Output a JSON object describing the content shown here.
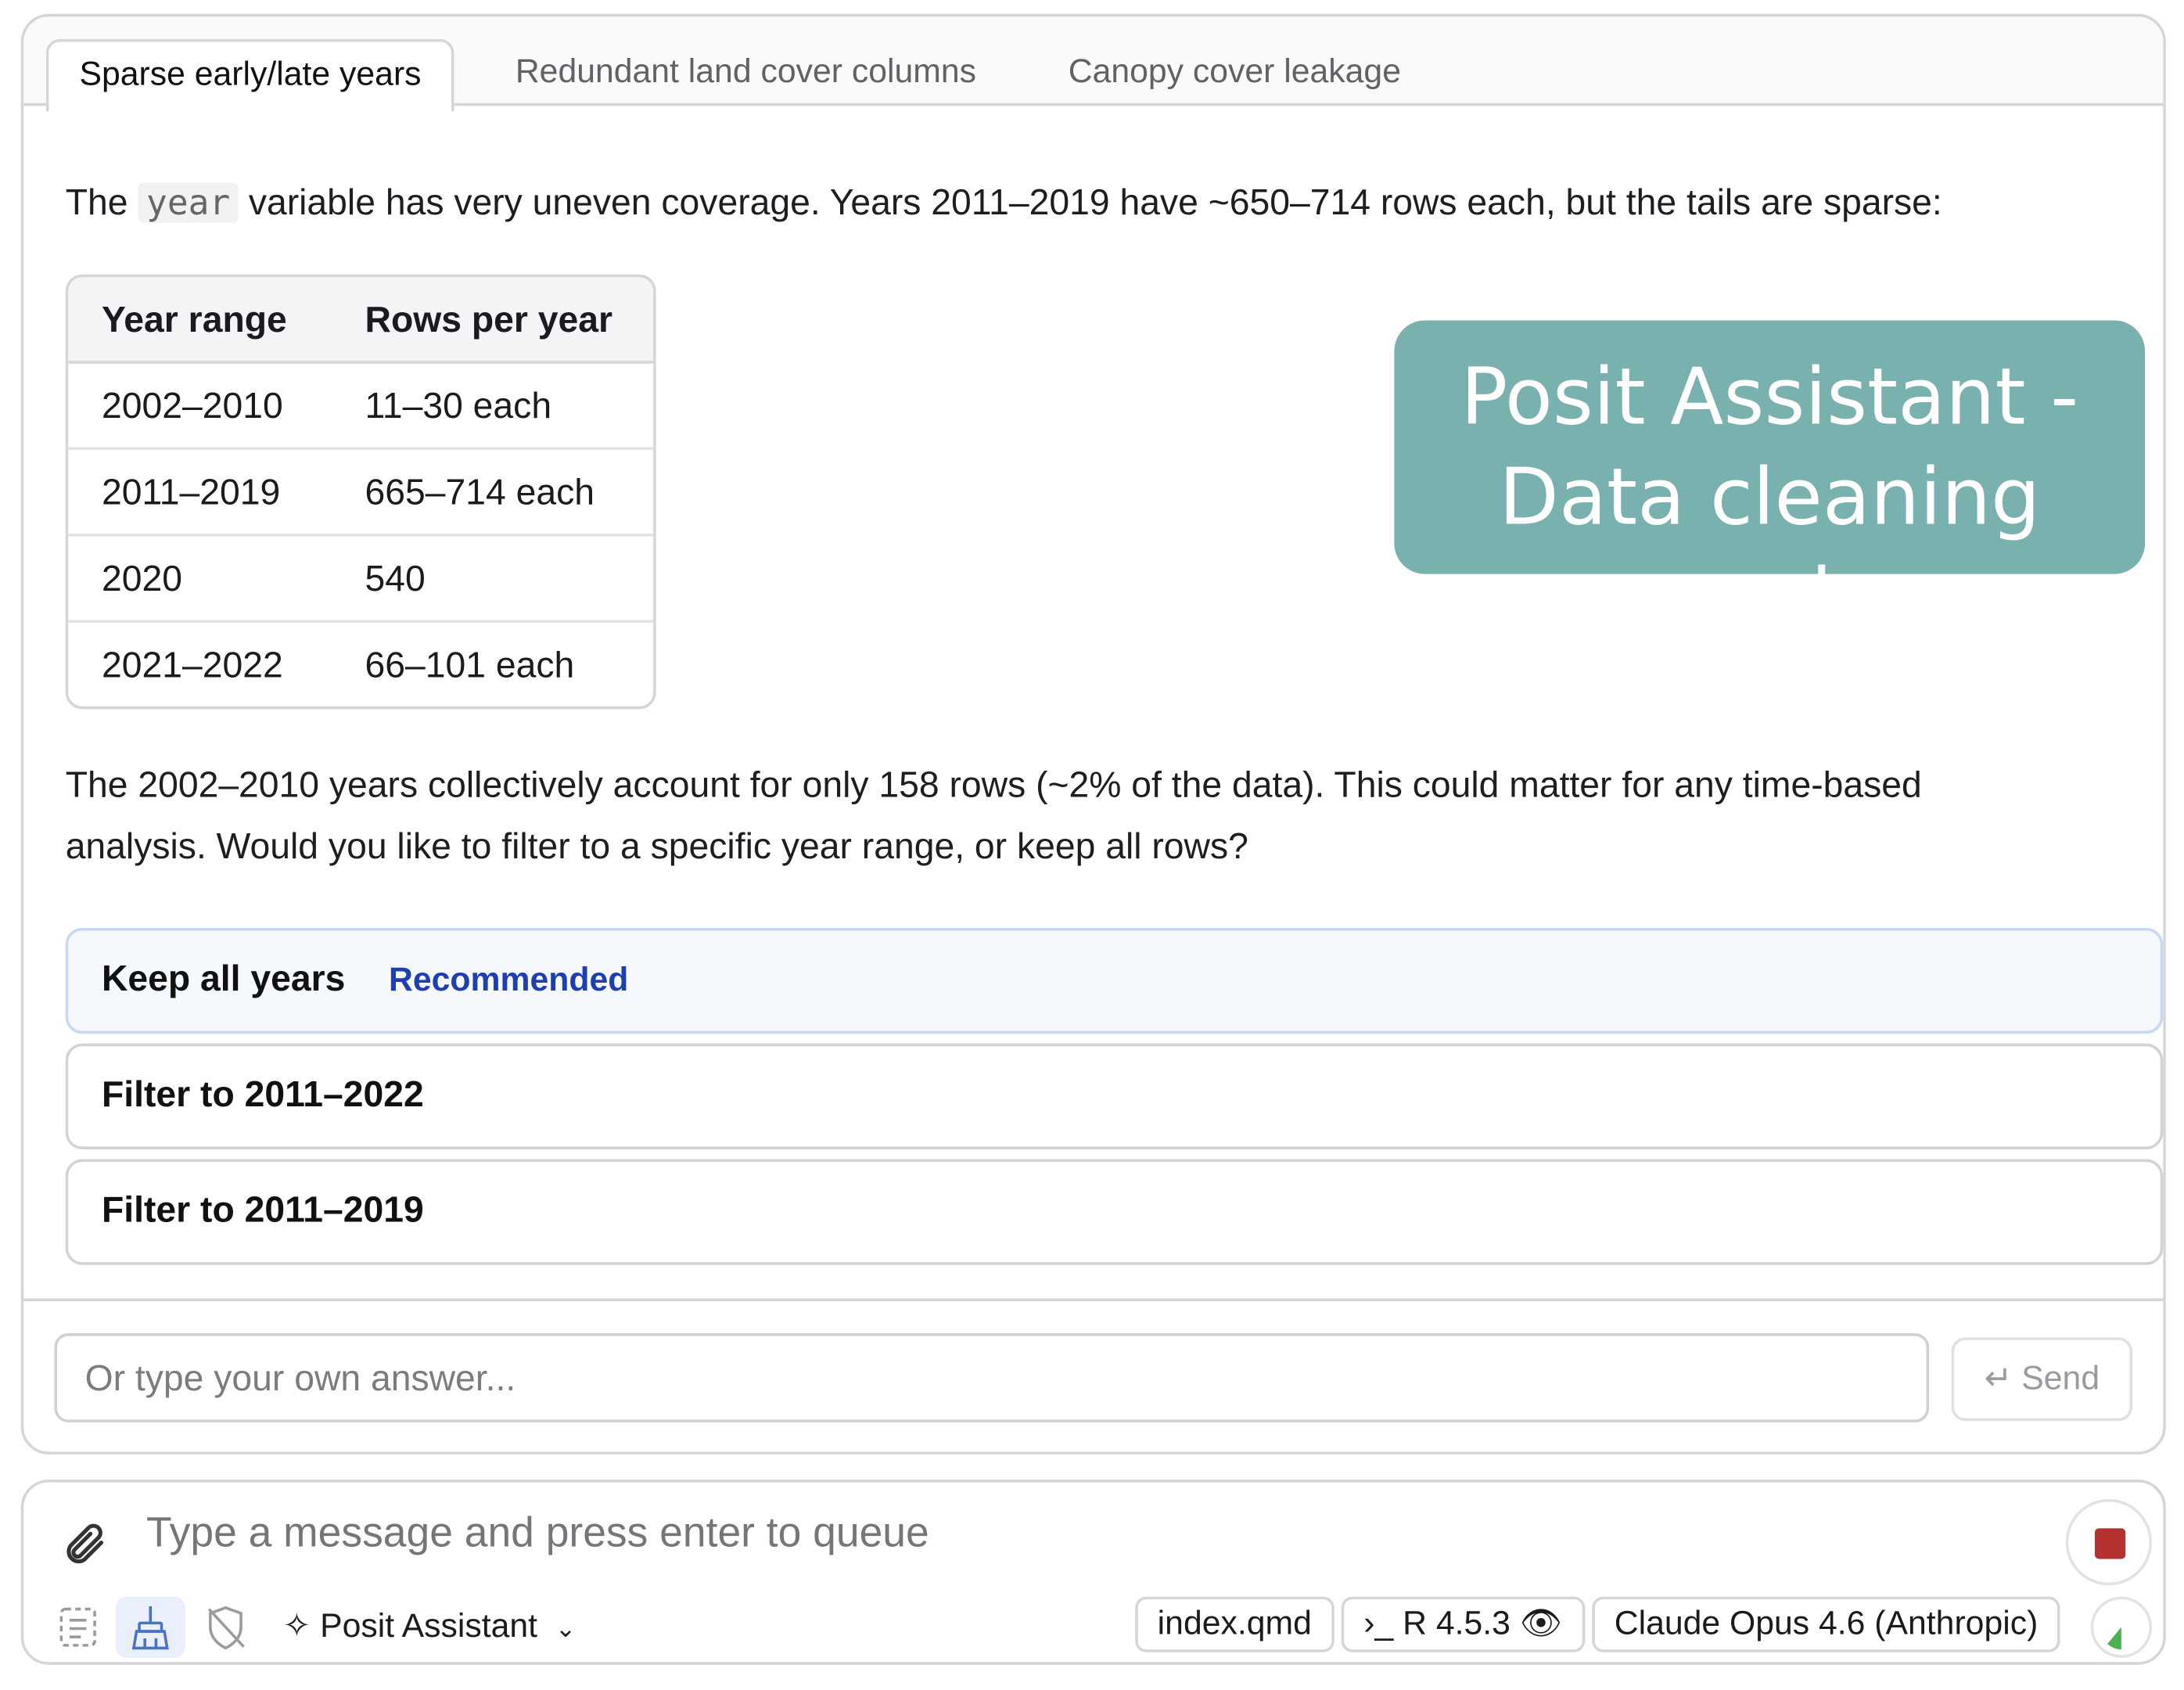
{
  "tabs": [
    {
      "label": "Sparse early/late years",
      "active": true
    },
    {
      "label": "Redundant land cover columns",
      "active": false
    },
    {
      "label": "Canopy cover leakage",
      "active": false
    }
  ],
  "intro": {
    "prefix": "The",
    "code": "year",
    "suffix": "variable has very uneven coverage. Years 2011–2019 have ~650–714 rows each, but the tails are sparse:"
  },
  "table": {
    "headers": [
      "Year range",
      "Rows per year"
    ],
    "rows": [
      [
        "2002–2010",
        "11–30 each"
      ],
      [
        "2011–2019",
        "665–714 each"
      ],
      [
        "2020",
        "540"
      ],
      [
        "2021–2022",
        "66–101 each"
      ]
    ]
  },
  "summary": {
    "line1": "The 2002–2010 years collectively account for only 158 rows (~2% of the data). This could matter for any time-based",
    "line2": "analysis. Would you like to filter to a specific year range, or keep all rows?"
  },
  "options": [
    {
      "label": "Keep all years",
      "badge": "Recommended"
    },
    {
      "label": "Filter to 2011–2022"
    },
    {
      "label": "Filter to 2011–2019"
    }
  ],
  "answer": {
    "placeholder": "Or type your own answer...",
    "send_label": "Send"
  },
  "banner": {
    "line1": "Posit Assistant -",
    "line2": "Data cleaning mode"
  },
  "composer": {
    "placeholder": "Type a message and press enter to queue",
    "assistant_label": "Posit Assistant",
    "file": "index.qmd",
    "runtime": "R 4.5.3",
    "model": "Claude Opus 4.6 (Anthropic)"
  },
  "colors": {
    "banner": "#78b1ae",
    "accent": "#1f3fb0",
    "stop": "#b3322f"
  }
}
